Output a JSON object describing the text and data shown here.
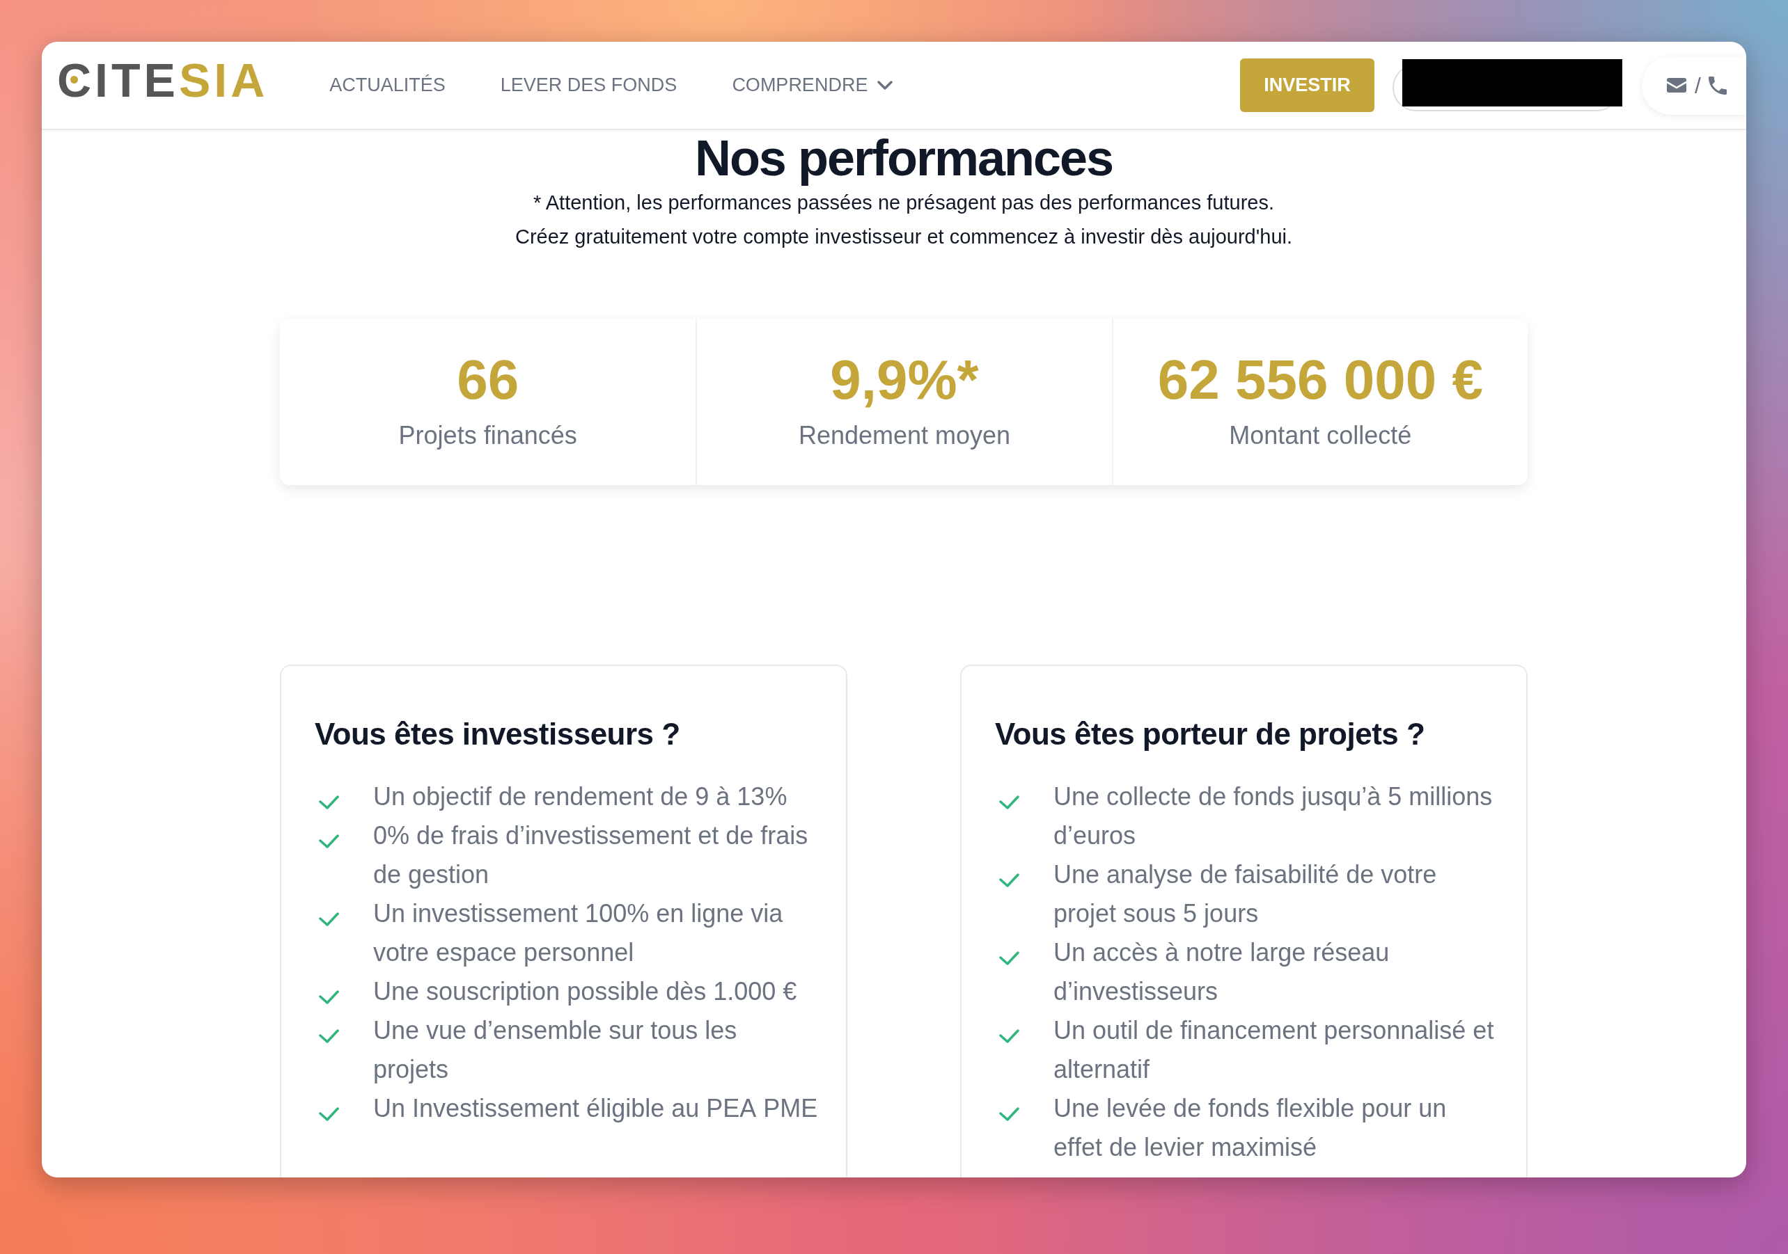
{
  "header": {
    "logo": [
      {
        "text": "CITE",
        "accent": false
      },
      {
        "text": "SIA",
        "accent": true
      }
    ],
    "nav": [
      {
        "label": "ACTUALITÉS",
        "dropdown": false
      },
      {
        "label": "LEVER DES FONDS",
        "dropdown": false
      },
      {
        "label": "COMPRENDRE",
        "dropdown": true
      }
    ],
    "cta": "INVESTIR",
    "contact_separator": "/"
  },
  "hero": {
    "title": "Nos performances",
    "lines": [
      "* Attention, les performances passées ne présagent pas des performances futures.",
      "Créez gratuitement votre compte investisseur et commencez à investir dès aujourd'hui."
    ]
  },
  "stats": [
    {
      "value": "66",
      "label": "Projets financés"
    },
    {
      "value": "9,9%*",
      "label": "Rendement moyen"
    },
    {
      "value": "62 556 000 €",
      "label": "Montant collecté"
    }
  ],
  "cards": [
    {
      "title": "Vous êtes investisseurs ?",
      "items": [
        "Un objectif de rendement de 9 à 13%",
        "0% de frais d’investissement et de frais de gestion",
        "Un investissement 100% en ligne via votre espace personnel",
        "Une souscription possible dès 1.000 €",
        "Une vue d’ensemble sur tous les projets",
        "Un Investissement éligible au PEA PME"
      ]
    },
    {
      "title": "Vous êtes porteur de projets ?",
      "items": [
        "Une collecte de fonds jusqu’à 5 millions d’euros",
        "Une analyse de faisabilité de votre projet sous 5 jours",
        "Un accès à notre large réseau d’investisseurs",
        "Un outil de financement personnalisé et alternatif",
        "Une levée de fonds flexible pour un effet de levier maximisé"
      ]
    }
  ]
}
